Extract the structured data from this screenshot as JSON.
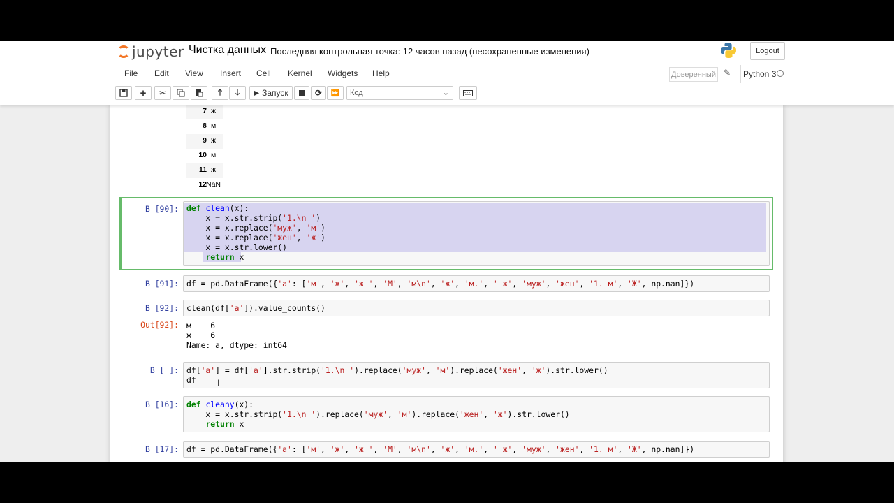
{
  "header": {
    "logo_text": "jupyter",
    "notebook_title": "Чистка данных",
    "checkpoint": "Последняя контрольная точка: 12 часов назад  (несохраненные изменения)",
    "logout_label": "Logout"
  },
  "menu": {
    "items": [
      "File",
      "Edit",
      "View",
      "Insert",
      "Cell",
      "Kernel",
      "Widgets",
      "Help"
    ],
    "trusted": "Доверенный",
    "kernel_name": "Python 3"
  },
  "toolbar": {
    "run_label": "Запуск",
    "cell_type": "Код",
    "icons": [
      "save-icon",
      "add-cell-icon",
      "cut-icon",
      "copy-icon",
      "paste-icon",
      "move-up-icon",
      "move-down-icon",
      "run-icon",
      "stop-icon",
      "restart-icon",
      "fast-forward-icon",
      "keyboard-icon"
    ]
  },
  "df_output": {
    "rows": [
      {
        "index": "7",
        "value": "ж"
      },
      {
        "index": "8",
        "value": "м"
      },
      {
        "index": "9",
        "value": "ж"
      },
      {
        "index": "10",
        "value": "м"
      },
      {
        "index": "11",
        "value": "ж"
      },
      {
        "index": "12",
        "value": "NaN"
      }
    ]
  },
  "cells": {
    "c90": {
      "prompt": "В [90]:",
      "lines": [
        "def clean(x):",
        "    x = x.str.strip('1.\\n ')",
        "    x = x.replace('муж', 'м')",
        "    x = x.replace('жен', 'ж')",
        "    x = x.str.lower()",
        "    return x"
      ]
    },
    "c91": {
      "prompt": "В [91]:",
      "lines": [
        "df = pd.DataFrame({'a': ['м', 'ж', 'ж ', 'М', 'м\\n', 'ж', 'м.', ' ж', 'муж', 'жен', '1. м', 'Ж', np.nan]})"
      ]
    },
    "c92": {
      "prompt": "В [92]:",
      "lines": [
        "clean(df['a']).value_counts()"
      ],
      "out_prompt": "Out[92]:",
      "output": [
        "м    6",
        "ж    6",
        "Name: a, dtype: int64"
      ]
    },
    "c_empty": {
      "prompt": "В [ ]:",
      "lines": [
        "df['a'] = df['a'].str.strip('1.\\n ').replace('муж', 'м').replace('жен', 'ж').str.lower()",
        "df"
      ]
    },
    "c16": {
      "prompt": "В [16]:",
      "lines": [
        "def cleany(x):",
        "    x = x.str.strip('1.\\n ').replace('муж', 'м').replace('жен', 'ж').str.lower()",
        "    return x"
      ]
    },
    "c17": {
      "prompt": "В [17]:",
      "lines": [
        "df = pd.DataFrame({'a': ['м', 'ж', 'ж ', 'М', 'м\\n', 'ж', 'м.', ' ж', 'муж', 'жен', '1. м', 'Ж', np.nan]})"
      ]
    }
  },
  "colors": {
    "prompt_in": "#303f9f",
    "prompt_out": "#d84315",
    "selected_border": "#66bb6a",
    "selection_bg": "#d7d4f0",
    "keyword": "#008000",
    "string": "#ba2121"
  }
}
